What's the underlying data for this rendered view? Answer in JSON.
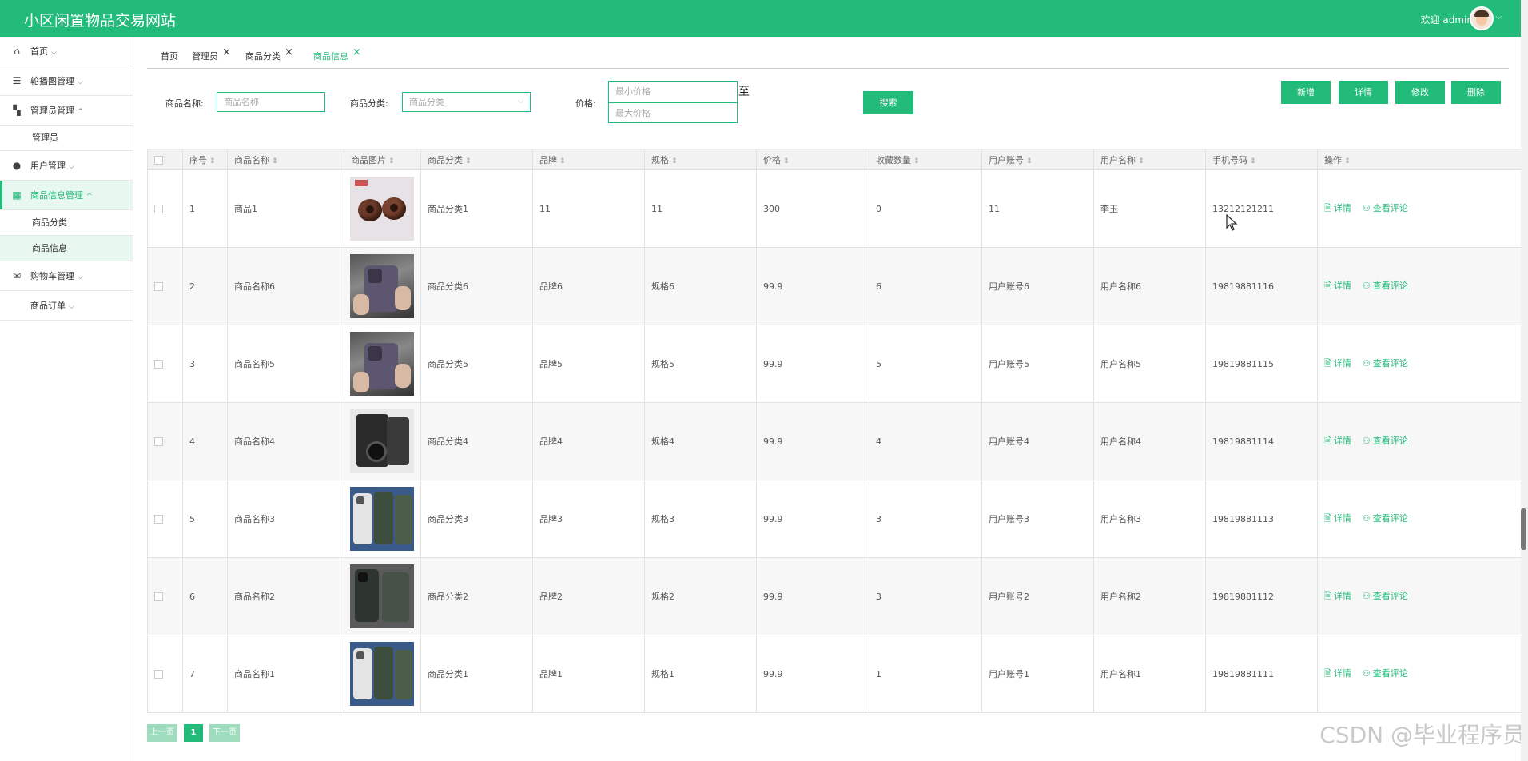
{
  "header": {
    "title": "小区闲置物品交易网站",
    "welcome": "欢迎 admin"
  },
  "sidebar": {
    "items": [
      {
        "label": "首页",
        "icon": "home-icon"
      },
      {
        "label": "轮播图管理",
        "icon": "carousel-icon"
      },
      {
        "label": "管理员管理",
        "icon": "admin-icon"
      },
      {
        "label": "管理员",
        "sub": true
      },
      {
        "label": "用户管理",
        "icon": "user-icon"
      },
      {
        "label": "商品信息管理",
        "icon": "grid-icon"
      },
      {
        "label": "商品分类",
        "sub": true
      },
      {
        "label": "商品信息",
        "sub": true
      },
      {
        "label": "购物车管理",
        "icon": "cart-icon"
      },
      {
        "label": "商品订单",
        "icon": ""
      }
    ]
  },
  "tabs": [
    {
      "label": "首页"
    },
    {
      "label": "管理员"
    },
    {
      "label": "商品分类"
    },
    {
      "label": "商品信息"
    }
  ],
  "filters": {
    "name_label": "商品名称:",
    "name_placeholder": "商品名称",
    "category_label": "商品分类:",
    "category_placeholder": "商品分类",
    "price_label": "价格:",
    "min_price_placeholder": "最小价格",
    "max_price_placeholder": "最大价格",
    "to_label": "至",
    "search_label": "搜索"
  },
  "toolbar": {
    "add": "新增",
    "detail": "详情",
    "edit": "修改",
    "delete": "删除"
  },
  "table": {
    "columns": [
      "序号",
      "商品名称",
      "商品图片",
      "商品分类",
      "品牌",
      "规格",
      "价格",
      "收藏数量",
      "用户账号",
      "用户名称",
      "手机号码",
      "操作"
    ],
    "rows": [
      {
        "no": "1",
        "name": "商品1",
        "category": "商品分类1",
        "brand": "11",
        "spec": "11",
        "price": "300",
        "fav": "0",
        "account": "11",
        "username": "李玉",
        "phone": "13212121211",
        "image": "brown-beads"
      },
      {
        "no": "2",
        "name": "商品名称6",
        "category": "商品分类6",
        "brand": "品牌6",
        "spec": "规格6",
        "price": "99.9",
        "fav": "6",
        "account": "用户账号6",
        "username": "用户名称6",
        "phone": "19819881116",
        "image": "purple-phone"
      },
      {
        "no": "3",
        "name": "商品名称5",
        "category": "商品分类5",
        "brand": "品牌5",
        "spec": "规格5",
        "price": "99.9",
        "fav": "5",
        "account": "用户账号5",
        "username": "用户名称5",
        "phone": "19819881115",
        "image": "purple-phone"
      },
      {
        "no": "4",
        "name": "商品名称4",
        "category": "商品分类4",
        "brand": "品牌4",
        "spec": "规格4",
        "price": "99.9",
        "fav": "4",
        "account": "用户账号4",
        "username": "用户名称4",
        "phone": "19819881114",
        "image": "black-device"
      },
      {
        "no": "5",
        "name": "商品名称3",
        "category": "商品分类3",
        "brand": "品牌3",
        "spec": "规格3",
        "price": "99.9",
        "fav": "3",
        "account": "用户账号3",
        "username": "用户名称3",
        "phone": "19819881113",
        "image": "green-phones"
      },
      {
        "no": "6",
        "name": "商品名称2",
        "category": "商品分类2",
        "brand": "品牌2",
        "spec": "规格2",
        "price": "99.9",
        "fav": "3",
        "account": "用户账号2",
        "username": "用户名称2",
        "phone": "19819881112",
        "image": "dark-phones"
      },
      {
        "no": "7",
        "name": "商品名称1",
        "category": "商品分类1",
        "brand": "品牌1",
        "spec": "规格1",
        "price": "99.9",
        "fav": "1",
        "account": "用户账号1",
        "username": "用户名称1",
        "phone": "19819881111",
        "image": "green-phones"
      }
    ],
    "action_detail": "详情",
    "action_comments": "查看评论"
  },
  "pager": {
    "prev": "上一页",
    "current": "1",
    "next": "下一页"
  },
  "watermark": "CSDN @毕业程序员",
  "colors": {
    "accent": "#23bb7a"
  }
}
